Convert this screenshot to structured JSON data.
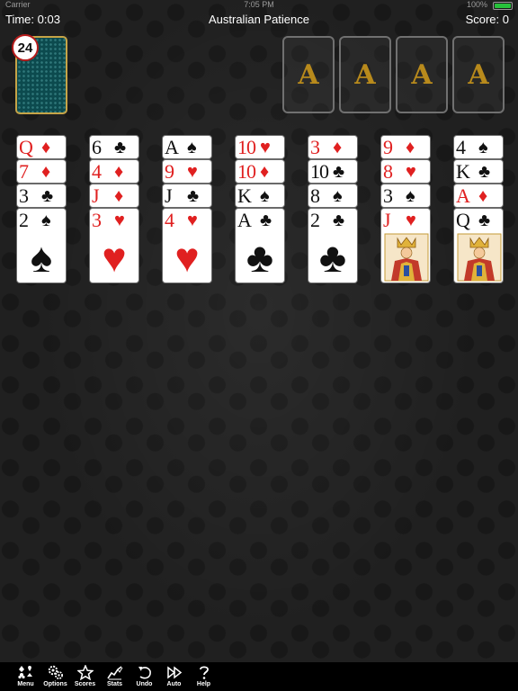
{
  "status_bar": {
    "carrier": "Carrier",
    "clock": "7:05 PM",
    "battery": "100%"
  },
  "header": {
    "time": "Time: 0:03",
    "title": "Australian Patience",
    "score": "Score: 0"
  },
  "stock": {
    "count": "24"
  },
  "foundations": [
    "A",
    "A",
    "A",
    "A"
  ],
  "tableau": [
    [
      {
        "rank": "Q",
        "suit": "♦",
        "color": "red"
      },
      {
        "rank": "7",
        "suit": "♦",
        "color": "red"
      },
      {
        "rank": "3",
        "suit": "♣",
        "color": "black"
      },
      {
        "rank": "2",
        "suit": "♠",
        "color": "black"
      }
    ],
    [
      {
        "rank": "6",
        "suit": "♣",
        "color": "black"
      },
      {
        "rank": "4",
        "suit": "♦",
        "color": "red"
      },
      {
        "rank": "J",
        "suit": "♦",
        "color": "red"
      },
      {
        "rank": "3",
        "suit": "♥",
        "color": "red"
      }
    ],
    [
      {
        "rank": "A",
        "suit": "♠",
        "color": "black"
      },
      {
        "rank": "9",
        "suit": "♥",
        "color": "red"
      },
      {
        "rank": "J",
        "suit": "♣",
        "color": "black"
      },
      {
        "rank": "4",
        "suit": "♥",
        "color": "red"
      }
    ],
    [
      {
        "rank": "10",
        "suit": "♥",
        "color": "red"
      },
      {
        "rank": "10",
        "suit": "♦",
        "color": "red"
      },
      {
        "rank": "K",
        "suit": "♠",
        "color": "black"
      },
      {
        "rank": "A",
        "suit": "♣",
        "color": "black"
      }
    ],
    [
      {
        "rank": "3",
        "suit": "♦",
        "color": "red"
      },
      {
        "rank": "10",
        "suit": "♣",
        "color": "black"
      },
      {
        "rank": "8",
        "suit": "♠",
        "color": "black"
      },
      {
        "rank": "2",
        "suit": "♣",
        "color": "black"
      }
    ],
    [
      {
        "rank": "9",
        "suit": "♦",
        "color": "red"
      },
      {
        "rank": "8",
        "suit": "♥",
        "color": "red"
      },
      {
        "rank": "3",
        "suit": "♠",
        "color": "black"
      },
      {
        "rank": "J",
        "suit": "♥",
        "color": "red",
        "face": "jack"
      }
    ],
    [
      {
        "rank": "4",
        "suit": "♠",
        "color": "black"
      },
      {
        "rank": "K",
        "suit": "♣",
        "color": "black"
      },
      {
        "rank": "A",
        "suit": "♦",
        "color": "red"
      },
      {
        "rank": "Q",
        "suit": "♣",
        "color": "black",
        "face": "queen"
      }
    ]
  ],
  "toolbar": [
    {
      "label": "Menu",
      "icon": "cards-suits-icon"
    },
    {
      "label": "Options",
      "icon": "gears-icon"
    },
    {
      "label": "Scores",
      "icon": "star-icon"
    },
    {
      "label": "Stats",
      "icon": "chart-icon"
    },
    {
      "label": "Undo",
      "icon": "undo-icon"
    },
    {
      "label": "Auto",
      "icon": "fast-forward-icon"
    },
    {
      "label": "Help",
      "icon": "question-icon"
    }
  ],
  "colors": {
    "card_red": "#e02020",
    "card_black": "#111111",
    "stock_back": "#0c4a4e",
    "stock_border": "#c6a447",
    "foundation_ace": "#b88a1c",
    "battery": "#27c13b"
  }
}
